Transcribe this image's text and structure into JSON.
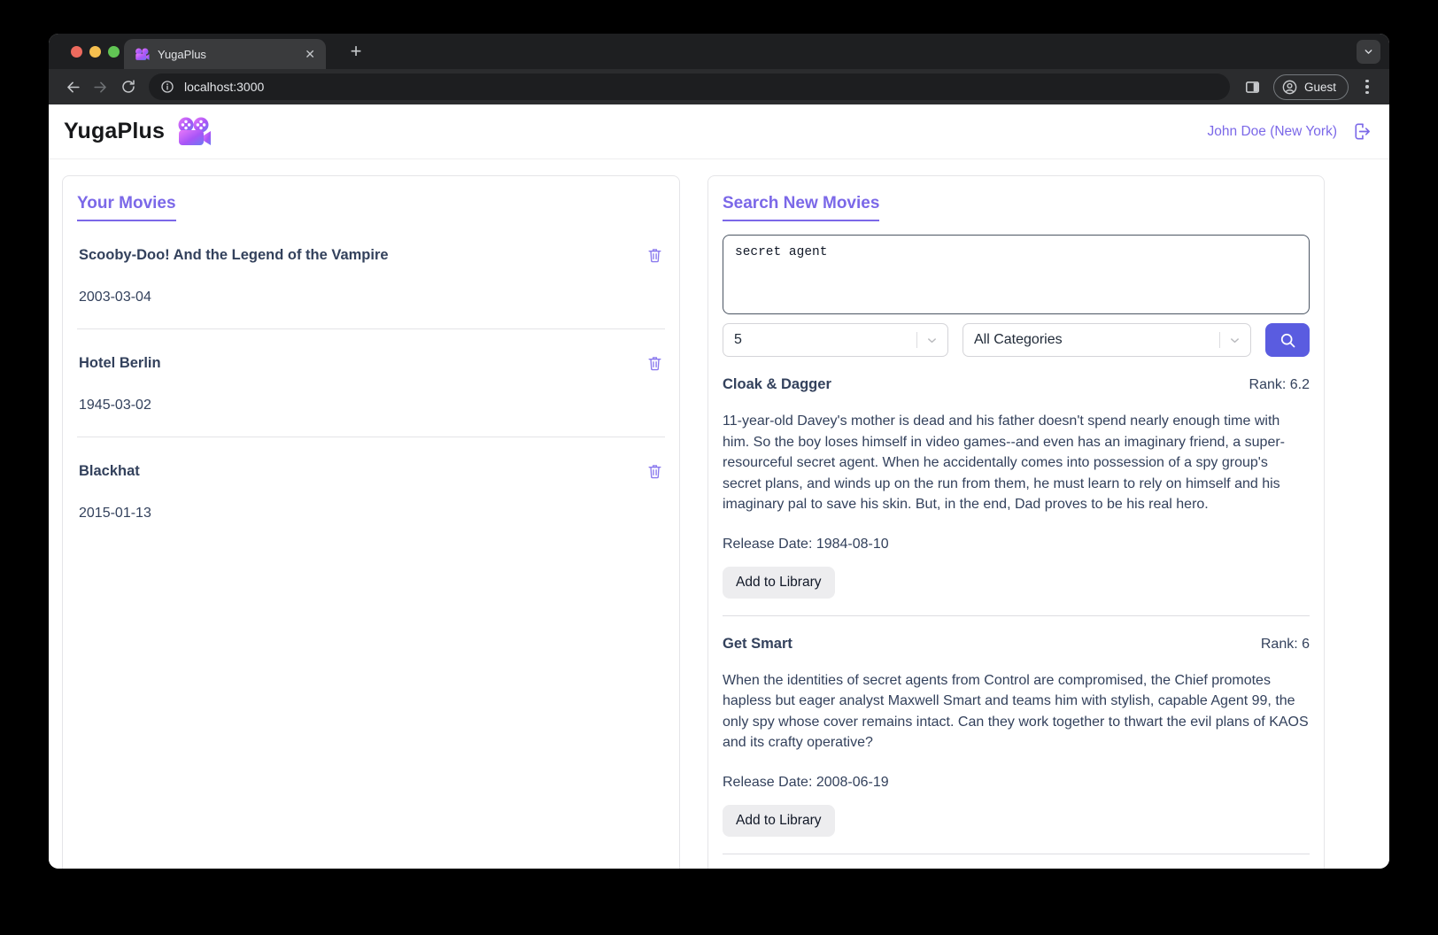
{
  "browser": {
    "tab": {
      "title": "YugaPlus",
      "close_glyph": "✕"
    },
    "new_tab_glyph": "+",
    "url": "localhost:3000",
    "profile_label": "Guest"
  },
  "header": {
    "brand": "YugaPlus",
    "user": "John Doe (New York)"
  },
  "library": {
    "title": "Your Movies",
    "movies": [
      {
        "title": "Scooby-Doo! And the Legend of the Vampire",
        "date": "2003-03-04"
      },
      {
        "title": "Hotel Berlin",
        "date": "1945-03-02"
      },
      {
        "title": "Blackhat",
        "date": "2015-01-13"
      }
    ]
  },
  "search": {
    "title": "Search New Movies",
    "query": "secret agent",
    "limit_value": "5",
    "category_value": "All Categories",
    "results": [
      {
        "title": "Cloak & Dagger",
        "rank": "Rank: 6.2",
        "description": "11-year-old Davey's mother is dead and his father doesn't spend nearly enough time with him. So the boy loses himself in video games--and even has an imaginary friend, a super-resourceful secret agent. When he accidentally comes into possession of a spy group's secret plans, and winds up on the run from them, he must learn to rely on himself and his imaginary pal to save his skin. But, in the end, Dad proves to be his real hero.",
        "release": "Release Date: 1984-08-10",
        "add_label": "Add to Library"
      },
      {
        "title": "Get Smart",
        "rank": "Rank: 6",
        "description": "When the identities of secret agents from Control are compromised, the Chief promotes hapless but eager analyst Maxwell Smart and teams him with stylish, capable Agent 99, the only spy whose cover remains intact. Can they work together to thwart the evil plans of KAOS and its crafty operative?",
        "release": "Release Date: 2008-06-19",
        "add_label": "Add to Library"
      }
    ]
  },
  "colors": {
    "accent_purple": "#7b68e8",
    "button_indigo": "#5a5ce0",
    "text_navy": "#33415c",
    "traffic_red": "#ed6a5e",
    "traffic_yellow": "#f5bf4f",
    "traffic_green": "#61c554"
  }
}
